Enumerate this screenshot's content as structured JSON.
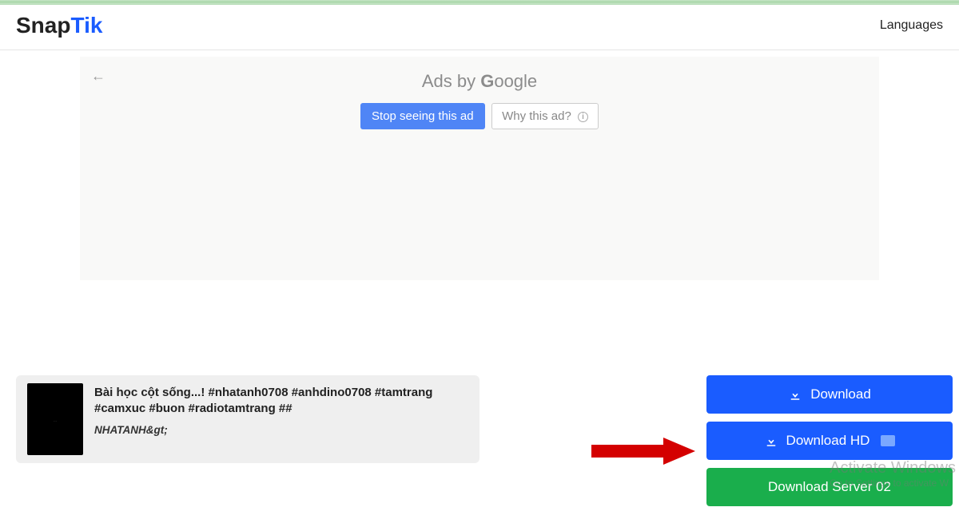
{
  "header": {
    "logo_snap": "Snap",
    "logo_tik": "Tik",
    "languages": "Languages"
  },
  "ad": {
    "prefix": "Ads by ",
    "google_g": "G",
    "google_rest": "oogle",
    "stop": "Stop seeing this ad",
    "why": "Why this ad?",
    "back_arrow": "←"
  },
  "video": {
    "title": "Bài học cột sống...! #nhatanh0708 #anhdino0708 #tamtrang #camxuc #buon #radiotamtrang ##",
    "author": "NHATANH&gt;"
  },
  "downloads": {
    "d1": "Download",
    "d2": "Download HD",
    "d3": "Download Server 02"
  },
  "watermark": {
    "title": "Activate Windows",
    "sub": "Go to Settings to activate W"
  }
}
